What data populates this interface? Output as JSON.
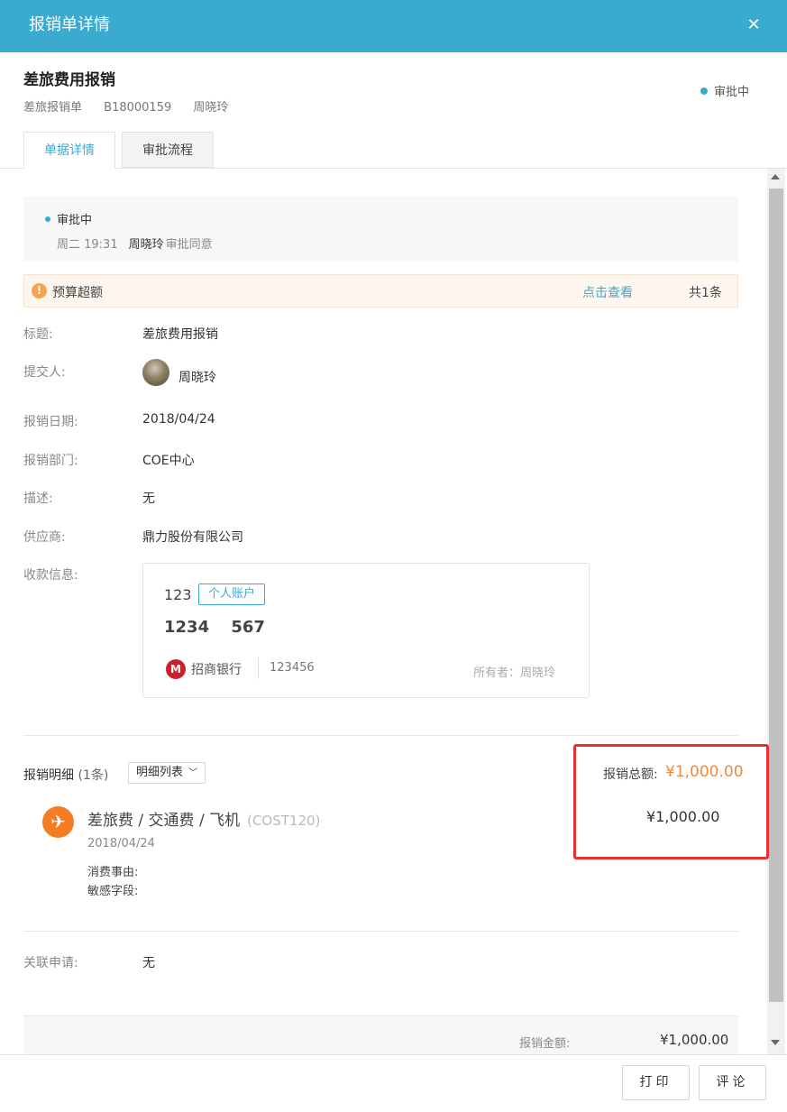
{
  "window": {
    "title": "报销单详情",
    "close_glyph": "✕"
  },
  "header": {
    "title": "差旅费用报销",
    "doc_type": "差旅报销单",
    "doc_no": "B18000159",
    "owner": "周晓玲",
    "status": "审批中"
  },
  "tabs": [
    {
      "label": "单据详情",
      "active": true
    },
    {
      "label": "审批流程",
      "active": false
    }
  ],
  "approval": {
    "status": "审批中",
    "time": "周二 19:31",
    "approver": "周晓玲",
    "action": "审批同意"
  },
  "budget": {
    "label": "预算超额",
    "link": "点击查看",
    "count": "共1条"
  },
  "fields": {
    "title_label": "标题:",
    "title_value": "差旅费用报销",
    "submitter_label": "提交人:",
    "submitter_value": "周晓玲",
    "date_label": "报销日期:",
    "date_value": "2018/04/24",
    "dept_label": "报销部门:",
    "dept_value": "COE中心",
    "desc_label": "描述:",
    "desc_value": "无",
    "supplier_label": "供应商:",
    "supplier_value": "鼎力股份有限公司",
    "payment_label": "收款信息:"
  },
  "payment": {
    "account_name": "123",
    "tag": "个人账户",
    "account_no": "1234 567",
    "bank": "招商银行",
    "bank_no": "123456",
    "owner": "所有者：周晓玲"
  },
  "details": {
    "label": "报销明细",
    "count": "(1条)",
    "view_select": "明细列表",
    "total_label": "报销总额:",
    "total_value": "¥1,000.00"
  },
  "expense": {
    "category": "差旅费 / 交通费 / 飞机",
    "code": "(COST120)",
    "date": "2018/04/24",
    "amount": "¥1,000.00",
    "reason_label": "消费事由:",
    "sensitive_label": "敏感字段:"
  },
  "related": {
    "label": "关联申请:",
    "value": "无"
  },
  "summary": {
    "label": "报销金额:",
    "value": "¥1,000.00"
  },
  "footer": {
    "print": "打印",
    "comment": "评论"
  },
  "colors": {
    "accent": "#3aabcf",
    "amount": "#f08a3a",
    "highlight": "#e83030",
    "expense_icon": "#f57c20"
  }
}
